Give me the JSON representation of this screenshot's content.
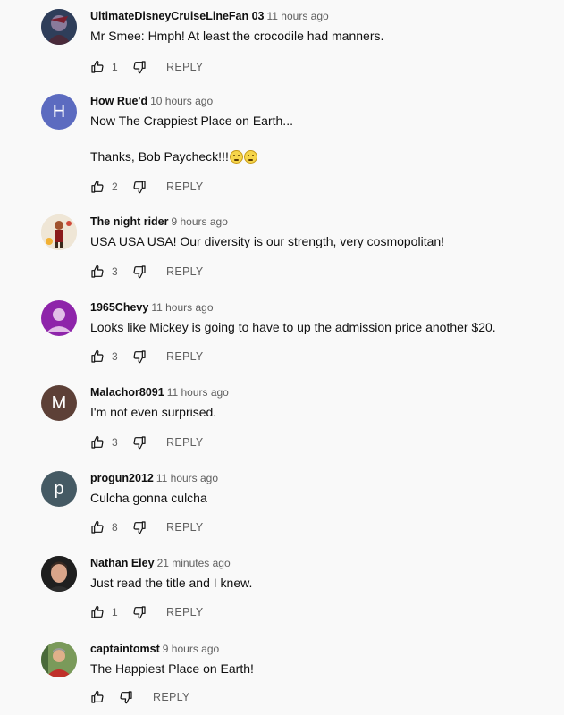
{
  "comments": [
    {
      "author": "UltimateDisneyCruiseLineFan 03",
      "time": "11 hours ago",
      "text": "Mr Smee: Hmph! At least the crocodile had manners.",
      "likes": "1",
      "reply": "REPLY",
      "avatar": {
        "type": "image",
        "color": "#3d4f6b"
      }
    },
    {
      "author": "How Rue'd",
      "time": "10 hours ago",
      "text": "Now The Crappiest Place on Earth...",
      "text2": "Thanks, Bob Paycheck!!!",
      "likes": "2",
      "reply": "REPLY",
      "avatar": {
        "type": "letter",
        "letter": "H",
        "color": "#5c6bc0"
      }
    },
    {
      "author": "The night rider",
      "time": "9 hours ago",
      "text": "USA USA USA! Our diversity is our strength, very cosmopolitan!",
      "likes": "3",
      "reply": "REPLY",
      "avatar": {
        "type": "image",
        "color": "#e8dcc8"
      }
    },
    {
      "author": "1965Chevy",
      "time": "11 hours ago",
      "text": "Looks like Mickey is going to have to up the admission price another $20.",
      "likes": "3",
      "reply": "REPLY",
      "avatar": {
        "type": "person",
        "color": "#8e24aa"
      }
    },
    {
      "author": "Malachor8091",
      "time": "11 hours ago",
      "text": "I'm not even surprised.",
      "likes": "3",
      "reply": "REPLY",
      "avatar": {
        "type": "letter",
        "letter": "M",
        "color": "#5d4037"
      }
    },
    {
      "author": "progun2012",
      "time": "11 hours ago",
      "text": "Culcha gonna culcha",
      "likes": "8",
      "reply": "REPLY",
      "avatar": {
        "type": "letter",
        "letter": "p",
        "color": "#455a64"
      }
    },
    {
      "author": "Nathan Eley",
      "time": "21 minutes ago",
      "text": "Just read the title and I knew.",
      "likes": "1",
      "reply": "REPLY",
      "avatar": {
        "type": "image",
        "color": "#2b2b2b"
      }
    },
    {
      "author": "captaintomst",
      "time": "9 hours ago",
      "text": "The Happiest Place on Earth!",
      "likes": "",
      "reply": "REPLY",
      "avatar": {
        "type": "image",
        "color": "#6b8f4e"
      }
    }
  ],
  "icons": {
    "like": "thumbs-up-icon",
    "dislike": "thumbs-down-icon"
  }
}
